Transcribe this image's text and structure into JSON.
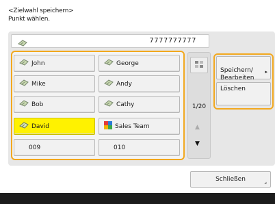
{
  "header": {
    "title": "<Zielwahl speichern>",
    "instruction": "Punkt wählen."
  },
  "number_field": {
    "value": "7777777777",
    "icon": "fax-icon"
  },
  "destinations": [
    {
      "label": "John",
      "icon": "fax-icon"
    },
    {
      "label": "George",
      "icon": "fax-icon"
    },
    {
      "label": "Mike",
      "icon": "fax-icon"
    },
    {
      "label": "Andy",
      "icon": "fax-icon"
    },
    {
      "label": "Bob",
      "icon": "fax-icon"
    },
    {
      "label": "Cathy",
      "icon": "fax-icon"
    },
    {
      "label": "David",
      "icon": "fax-icon",
      "selected": true
    },
    {
      "label": "Sales Team",
      "icon": "group-icon"
    },
    {
      "label": "009"
    },
    {
      "label": "010"
    }
  ],
  "pager": {
    "page": "1/20"
  },
  "actions": {
    "save_edit": "Speichern/\nBearbeiten",
    "delete": "Löschen"
  },
  "footer": {
    "close_label": "Schließen"
  },
  "colors": {
    "highlight_frame": "#f2a81e",
    "selected": "#fff200"
  }
}
